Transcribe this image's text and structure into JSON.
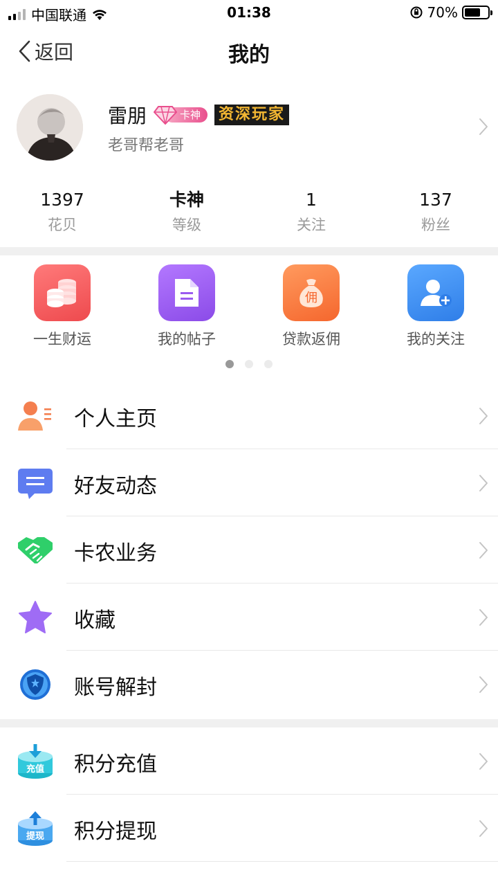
{
  "status_bar": {
    "carrier": "中国联通",
    "time": "01:38",
    "battery_percent": "70%",
    "battery_level": 0.7
  },
  "nav": {
    "back_label": "返回",
    "title": "我的"
  },
  "profile": {
    "name": "雷朋",
    "level_badge": "卡神",
    "title_badge": "资深玩家",
    "subtitle": "老哥帮老哥"
  },
  "stats": [
    {
      "value": "1397",
      "label": "花贝"
    },
    {
      "value": "卡神",
      "label": "等级"
    },
    {
      "value": "1",
      "label": "关注"
    },
    {
      "value": "137",
      "label": "粉丝"
    }
  ],
  "shortcuts": [
    {
      "label": "一生财运",
      "icon": "coins-icon",
      "color": "#f2595c"
    },
    {
      "label": "我的帖子",
      "icon": "document-icon",
      "color": "#9b5bf0"
    },
    {
      "label": "贷款返佣",
      "icon": "money-bag-icon",
      "color": "#f7743d"
    },
    {
      "label": "我的关注",
      "icon": "add-user-icon",
      "color": "#3d8cf0"
    }
  ],
  "pager": {
    "pages": 3,
    "active": 1
  },
  "menu_group_1": [
    {
      "label": "个人主页",
      "icon": "profile-card-icon"
    },
    {
      "label": "好友动态",
      "icon": "chat-bubble-icon"
    },
    {
      "label": "卡农业务",
      "icon": "handshake-icon"
    },
    {
      "label": "收藏",
      "icon": "star-icon"
    },
    {
      "label": "账号解封",
      "icon": "shield-icon"
    }
  ],
  "menu_group_2": [
    {
      "label": "积分充值",
      "icon": "recharge-icon",
      "badge_text": "充值"
    },
    {
      "label": "积分提现",
      "icon": "withdraw-icon",
      "badge_text": "提现"
    },
    {
      "label": "",
      "icon": "partial-item-icon"
    }
  ],
  "colors": {
    "accent_red": "#f2595c",
    "accent_purple": "#9b5bf0",
    "accent_orange": "#f7743d",
    "accent_blue": "#3d8cf0",
    "green": "#2fcf6a",
    "badge_pink": "#e94f8d",
    "badge_gold": "#f2b632"
  }
}
